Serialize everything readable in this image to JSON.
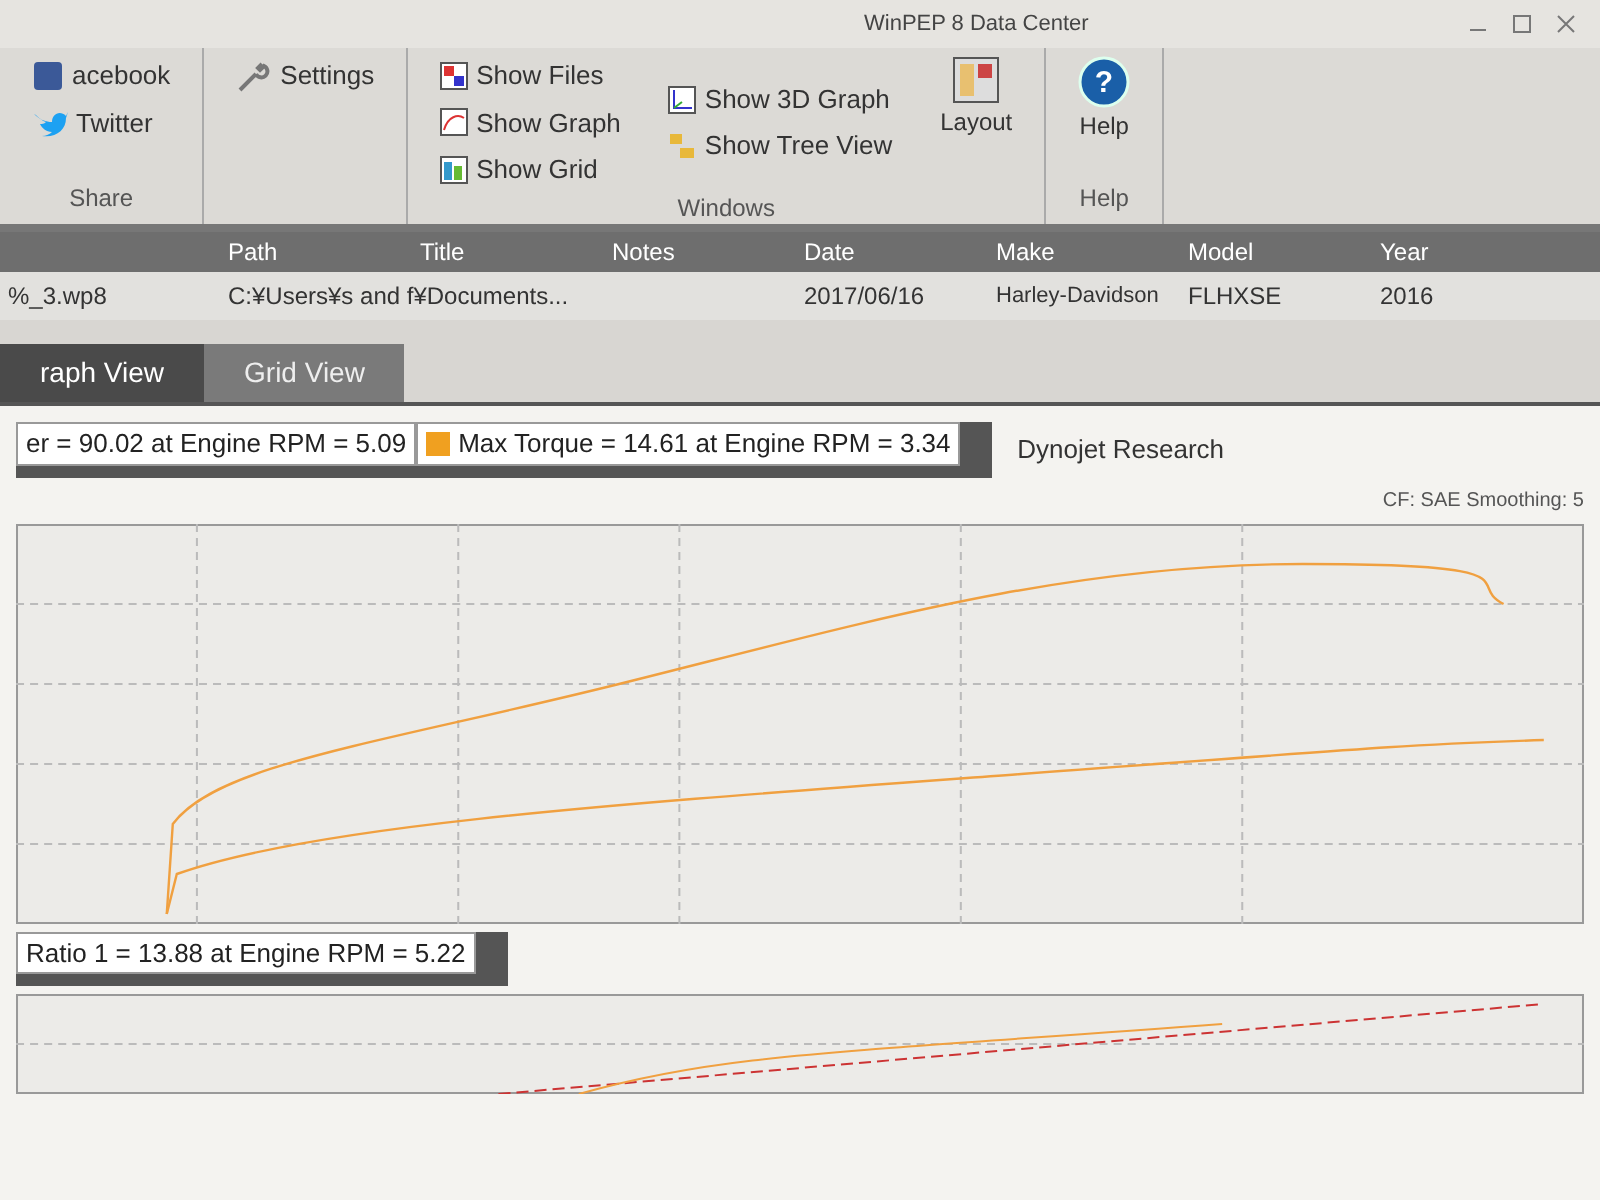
{
  "window": {
    "title": "WinPEP 8 Data Center"
  },
  "ribbon": {
    "groups": [
      {
        "label": "Share",
        "items": [
          {
            "kind": "social",
            "label": "acebook"
          },
          {
            "kind": "bird",
            "label": "Twitter"
          }
        ]
      },
      {
        "items": [
          {
            "kind": "wrench",
            "label": "Settings"
          }
        ]
      },
      {
        "label": "Windows",
        "items": [
          {
            "kind": "files",
            "label": "Show Files"
          },
          {
            "kind": "graph",
            "label": "Show Graph"
          },
          {
            "kind": "grid",
            "label": "Show Grid"
          },
          {
            "kind": "graph3d",
            "label": "Show 3D Graph"
          },
          {
            "kind": "tree",
            "label": "Show Tree View"
          },
          {
            "kind": "layout",
            "label": "Layout"
          }
        ]
      },
      {
        "label": "Help",
        "items": [
          {
            "kind": "help",
            "label": "Help",
            "glyph": "?"
          }
        ]
      }
    ]
  },
  "files": {
    "columns": [
      "Path",
      "Title",
      "Notes",
      "Date",
      "Make",
      "Model",
      "Year"
    ],
    "row": {
      "file": "%_3.wp8",
      "path": "C:¥Users¥s and f¥Documents...",
      "date": "2017/06/16",
      "make": "Harley-Davidson",
      "model": "FLHXSE",
      "year": "2016"
    }
  },
  "tabs": [
    {
      "label": "raph View",
      "selected": true
    },
    {
      "label": "Grid View",
      "selected": false
    }
  ],
  "graph": {
    "title": "Dynojet Research",
    "note": "CF: SAE Smoothing: 5",
    "legend": [
      {
        "label": "er = 90.02 at Engine RPM = 5.09"
      },
      {
        "label": "Max Torque = 14.61 at Engine RPM = 3.34",
        "color": "#f0a020"
      }
    ]
  },
  "graph2": {
    "legend": [
      {
        "label": "Ratio 1 = 13.88 at Engine RPM = 5.22"
      }
    ]
  }
}
